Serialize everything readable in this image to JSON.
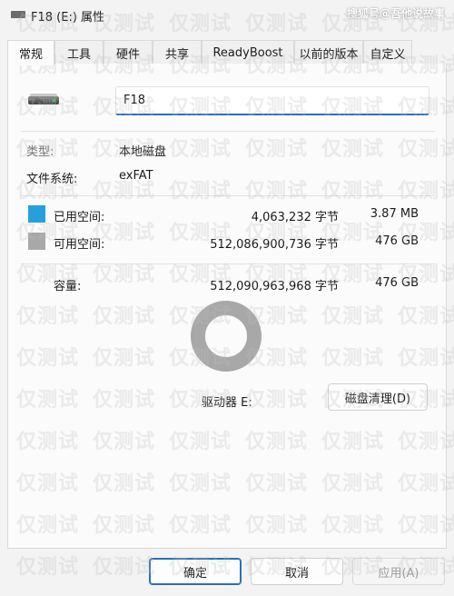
{
  "window": {
    "title": "F18 (E:) 属性",
    "corner_watermark": "搜狐号@吾他说故事"
  },
  "tabs": [
    {
      "label": "常规",
      "active": true
    },
    {
      "label": "工具"
    },
    {
      "label": "硬件"
    },
    {
      "label": "共享"
    },
    {
      "label": "ReadyBoost"
    },
    {
      "label": "以前的版本"
    },
    {
      "label": "自定义"
    }
  ],
  "general": {
    "drive_name": "F18",
    "type_label": "类型:",
    "type_value": "本地磁盘",
    "fs_label": "文件系统:",
    "fs_value": "exFAT",
    "used_label": "已用空间:",
    "used_bytes": "4,063,232 字节",
    "used_size": "3.87 MB",
    "free_label": "可用空间:",
    "free_bytes": "512,086,900,736 字节",
    "free_size": "476 GB",
    "capacity_label": "容量:",
    "capacity_bytes": "512,090,963,968 字节",
    "capacity_size": "476 GB",
    "drive_label": "驱动器 E:",
    "cleanup_button": "磁盘清理(D)",
    "used_fraction": 7.9e-06
  },
  "colors": {
    "used": "#26a0da",
    "free": "#a8a8a8",
    "accent": "#2b6fb8"
  },
  "footer": {
    "ok": "确定",
    "cancel": "取消",
    "apply": "应用(A)"
  },
  "watermark_text": "仅测试"
}
